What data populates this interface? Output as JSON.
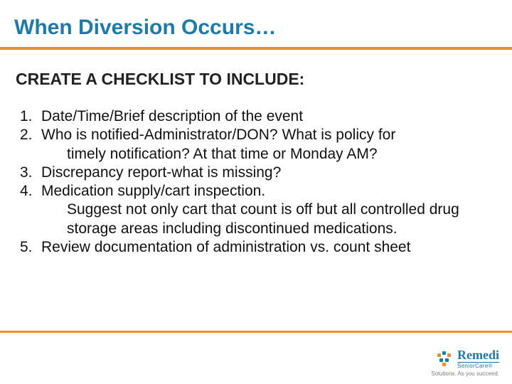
{
  "title": "When Diversion Occurs…",
  "subtitle": "CREATE A CHECKLIST TO INCLUDE:",
  "items": [
    {
      "num": "1.",
      "text": "Date/Time/Brief description of the event",
      "extra": ""
    },
    {
      "num": "2.",
      "text": "Who is notified-Administrator/DON?   What is policy for",
      "extra": "timely notification? At that time or Monday AM?"
    },
    {
      "num": "3.",
      "text": " Discrepancy report-what is missing?",
      "extra": ""
    },
    {
      "num": "4.",
      "text": " Medication supply/cart inspection.",
      "extra": "Suggest not only cart that count is off but all controlled drug storage areas including discontinued medications."
    },
    {
      "num": "5.",
      "text": " Review documentation of administration vs. count sheet",
      "extra": ""
    }
  ],
  "brand": {
    "name": "Remedi",
    "sub": "SeniorCare®",
    "tagline": "Solutions. As you succeed."
  },
  "colors": {
    "accent_blue": "#1d7ba6",
    "accent_orange": "#e98f2e"
  }
}
